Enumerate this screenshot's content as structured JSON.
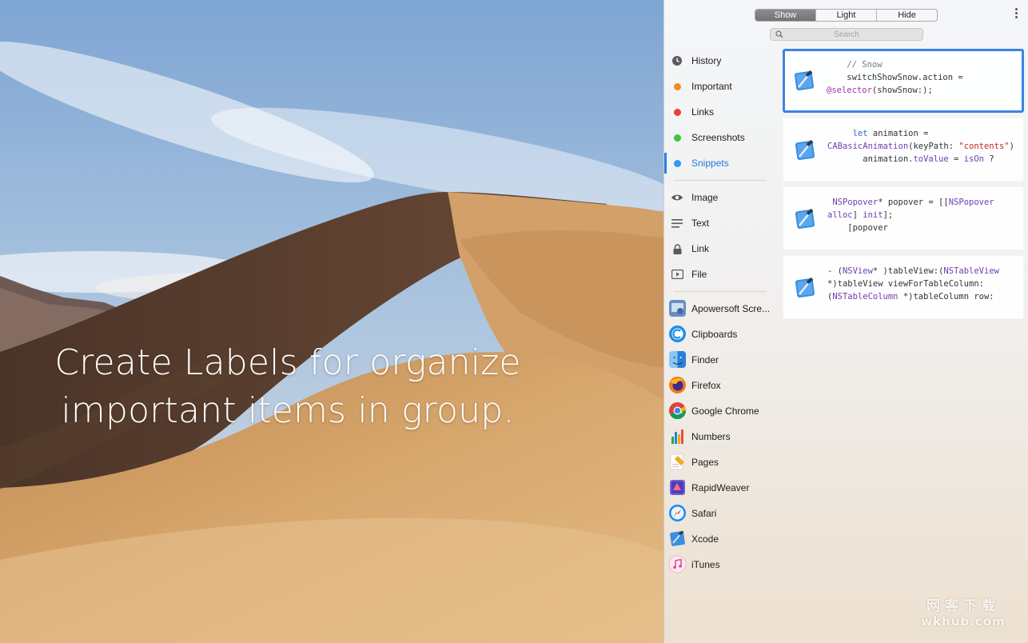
{
  "headline": {
    "line1": "Create Labels for organize",
    "line2": "important items in group."
  },
  "toolbar": {
    "segments": [
      "Show",
      "Light",
      "Hide"
    ],
    "active_segment": "Show"
  },
  "search": {
    "placeholder": "Search"
  },
  "sidebar": {
    "labels": [
      {
        "label": "History",
        "icon": "history-icon"
      },
      {
        "label": "Important",
        "icon": "orange-dot",
        "color": "#f28a1d"
      },
      {
        "label": "Links",
        "icon": "red-dot",
        "color": "#e8413a"
      },
      {
        "label": "Screenshots",
        "icon": "green-dot",
        "color": "#3cc63a"
      },
      {
        "label": "Snippets",
        "icon": "blue-dot",
        "color": "#2d9bf0",
        "selected": true
      }
    ],
    "types": [
      {
        "label": "Image",
        "icon": "eye-icon"
      },
      {
        "label": "Text",
        "icon": "lines-icon"
      },
      {
        "label": "Link",
        "icon": "lock-icon"
      },
      {
        "label": "File",
        "icon": "play-file-icon"
      }
    ],
    "apps": [
      {
        "label": "Apowersoft Scre...",
        "icon": "apowersoft-icon"
      },
      {
        "label": "Clipboards",
        "icon": "clipboards-icon"
      },
      {
        "label": "Finder",
        "icon": "finder-icon"
      },
      {
        "label": "Firefox",
        "icon": "firefox-icon"
      },
      {
        "label": "Google Chrome",
        "icon": "chrome-icon"
      },
      {
        "label": "Numbers",
        "icon": "numbers-icon"
      },
      {
        "label": "Pages",
        "icon": "pages-icon"
      },
      {
        "label": "RapidWeaver",
        "icon": "rapidweaver-icon"
      },
      {
        "label": "Safari",
        "icon": "safari-icon"
      },
      {
        "label": "Xcode",
        "icon": "xcode-icon"
      },
      {
        "label": "iTunes",
        "icon": "itunes-icon"
      }
    ]
  },
  "snippets": [
    {
      "selected": true,
      "app_icon": "xcode-icon",
      "lines": [
        [
          [
            "cm",
            "    // Snow"
          ]
        ],
        [
          [
            "",
            "    switchShowSnow.action ="
          ]
        ],
        [
          [
            "kw",
            "@selector"
          ],
          [
            "",
            "(showSnow:);"
          ]
        ]
      ]
    },
    {
      "selected": false,
      "app_icon": "xcode-icon",
      "lines": [
        [
          [
            "",
            "     "
          ],
          [
            "bl",
            "let"
          ],
          [
            "",
            " animation ="
          ]
        ],
        [
          [
            "ty",
            "CABasicAnimation"
          ],
          [
            "",
            "(keyPath: "
          ],
          [
            "st",
            "\"contents\""
          ],
          [
            "",
            ")"
          ]
        ],
        [
          [
            "",
            "       animation."
          ],
          [
            "ty",
            "toValue"
          ],
          [
            "",
            " = "
          ],
          [
            "ty",
            "isOn"
          ],
          [
            "",
            " ?"
          ]
        ]
      ]
    },
    {
      "selected": false,
      "app_icon": "xcode-icon",
      "lines": [
        [
          [
            "",
            " "
          ],
          [
            "ty",
            "NSPopover"
          ],
          [
            "",
            "* popover = [["
          ],
          [
            "ty",
            "NSPopover"
          ]
        ],
        [
          [
            "ty",
            "alloc"
          ],
          [
            "",
            "] "
          ],
          [
            "ty",
            "init"
          ],
          [
            "",
            "];"
          ]
        ],
        [
          [
            "",
            "    [popover"
          ]
        ]
      ]
    },
    {
      "selected": false,
      "app_icon": "xcode-icon",
      "lines": [
        [
          [
            "",
            "- ("
          ],
          [
            "ty",
            "NSView"
          ],
          [
            "",
            "* )tableView:("
          ],
          [
            "ty",
            "NSTableView"
          ]
        ],
        [
          [
            "",
            "*)tableView viewForTableColumn:"
          ]
        ],
        [
          [
            "",
            "("
          ],
          [
            "ty",
            "NSTableColumn"
          ],
          [
            "",
            " *)tableColumn row:"
          ]
        ]
      ]
    }
  ],
  "watermark": {
    "line1": "网客下载",
    "line2": "wkhub.com"
  }
}
